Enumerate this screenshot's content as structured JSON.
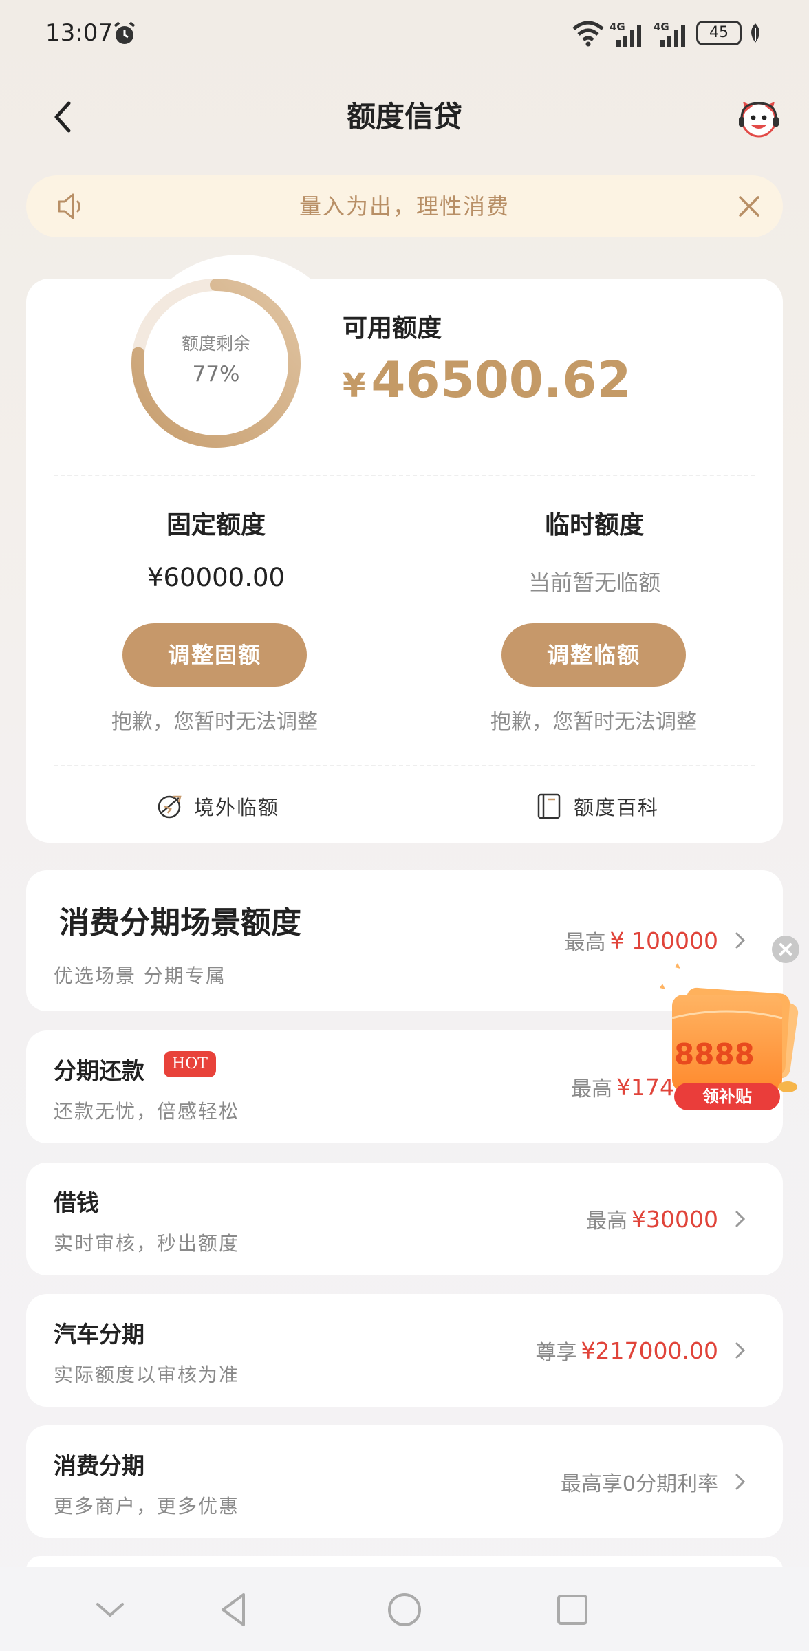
{
  "status_bar": {
    "time": "13:07",
    "battery": "45",
    "network1": "4G",
    "network2": "4G"
  },
  "header": {
    "title": "额度信贷",
    "back_icon": "back-arrow-icon",
    "service_icon": "customer-service-icon"
  },
  "notice": {
    "text": "量入为出，理性消费",
    "icon": "speaker-icon"
  },
  "credit": {
    "ring_label": "额度剩余",
    "ring_value": "77%",
    "ring_fraction": 0.77,
    "available_label": "可用额度",
    "available_currency": "¥",
    "available_amount": "46500.62",
    "fixed": {
      "title": "固定额度",
      "amount": "¥60000.00",
      "button": "调整固额",
      "note": "抱歉，您暂时无法调整"
    },
    "temp": {
      "title": "临时额度",
      "amount": "当前暂无临额",
      "button": "调整临额",
      "note": "抱歉，您暂时无法调整"
    },
    "links": [
      {
        "label": "境外临额",
        "icon": "globe-plane-icon"
      },
      {
        "label": "额度百科",
        "icon": "book-icon"
      }
    ]
  },
  "list": [
    {
      "title": "消费分期场景额度",
      "subtitle": "优选场景 分期专属",
      "prefix": "最高",
      "amount": "¥ 100000"
    },
    {
      "title": "分期还款",
      "badge": "HOT",
      "subtitle": "还款无忧，倍感轻松",
      "prefix": "最高",
      "amount": "¥174"
    },
    {
      "title": "借钱",
      "subtitle": "实时审核，秒出额度",
      "prefix": "最高",
      "amount": "¥30000"
    },
    {
      "title": "汽车分期",
      "subtitle": "实际额度以审核为准",
      "prefix": "尊享",
      "amount": "¥217000.00"
    },
    {
      "title": "消费分期",
      "subtitle": "更多商户，更多优惠",
      "prefix": "最高享0分期利率",
      "amount": ""
    }
  ],
  "promo": {
    "amount": "8888",
    "button": "领补贴"
  },
  "colors": {
    "accent": "#c6986a",
    "price_red": "#e0443a",
    "notice_bg": "#fcf3e3"
  }
}
